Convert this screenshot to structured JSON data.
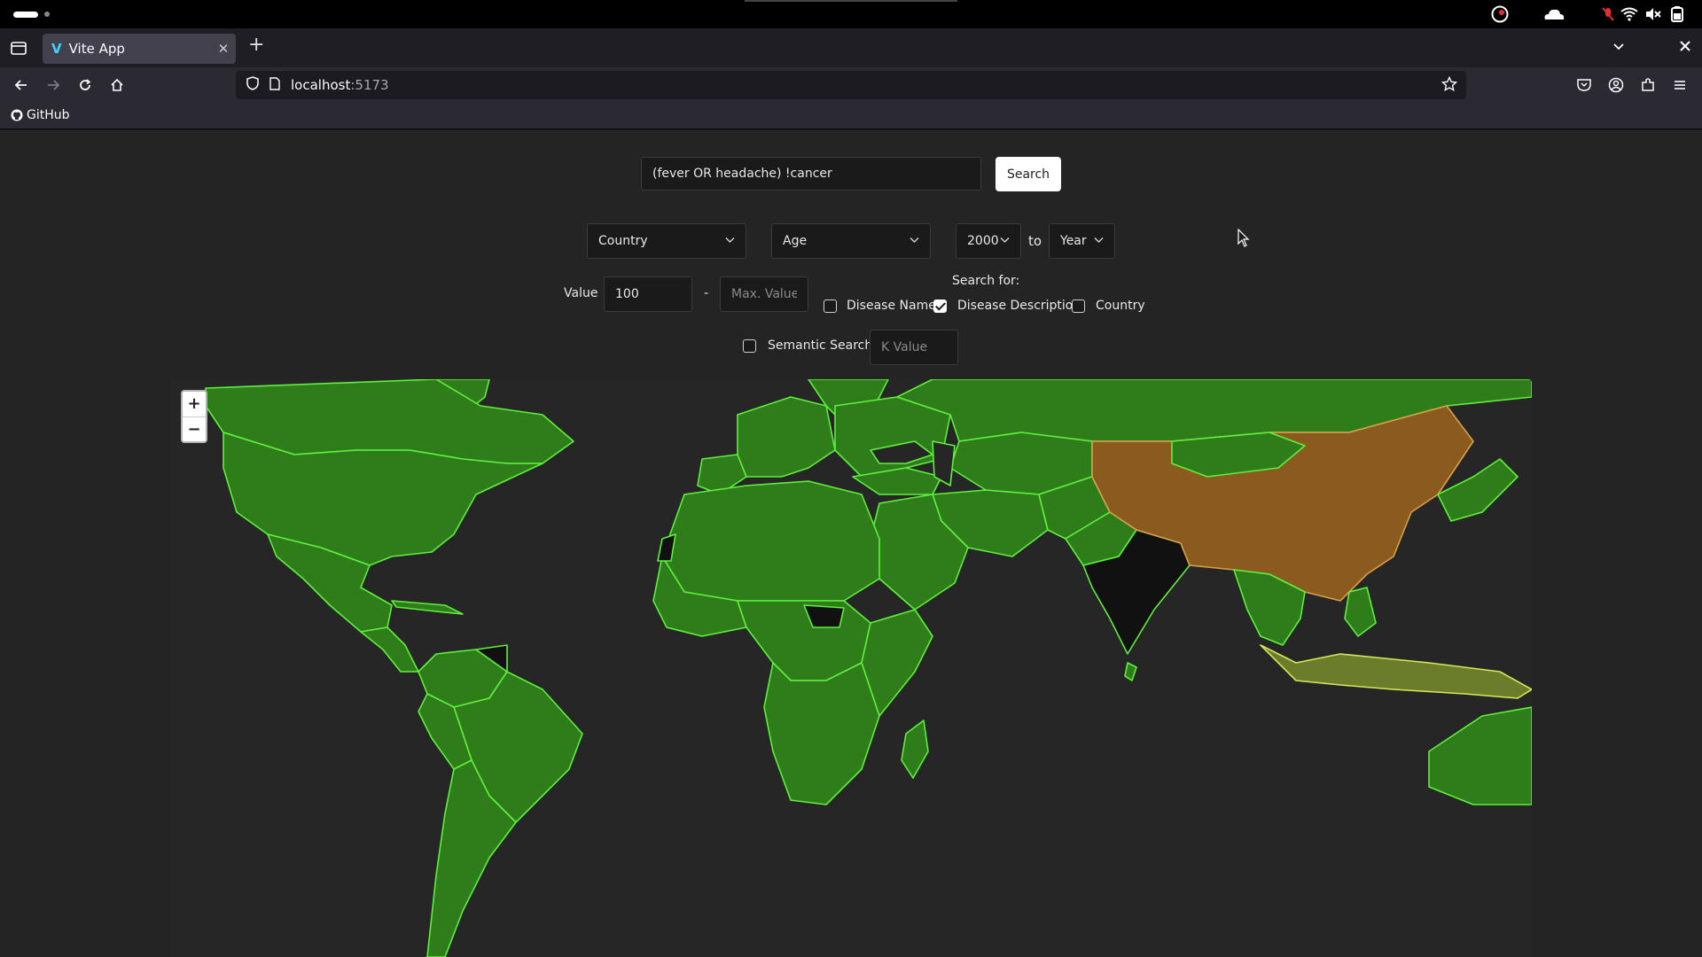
{
  "browser": {
    "tab_title": "Vite App",
    "tab_close": "✕",
    "new_tab": "+",
    "url_host": "localhost",
    "url_port": ":5173",
    "bookmark": "GitHub"
  },
  "search": {
    "query": "(fever OR headache) !cancer",
    "button_label": "Search"
  },
  "filters": {
    "country_label": "Country",
    "age_label": "Age",
    "year_from": "2000",
    "to_label": "to",
    "year_to": "Year"
  },
  "value_filter": {
    "label": "Value",
    "min_value": "100",
    "max_placeholder": "Max. Value",
    "dash": "-"
  },
  "search_for": {
    "title": "Search for:",
    "options": [
      {
        "label": "Disease Name",
        "checked": false
      },
      {
        "label": "Disease Description",
        "checked": true
      },
      {
        "label": "Country",
        "checked": false
      }
    ]
  },
  "semantic": {
    "label": "Semantic Search",
    "checked": false,
    "k_placeholder": "K Value"
  },
  "map": {
    "zoom_in": "+",
    "zoom_out": "−",
    "colors": {
      "land": "#2e7d1a",
      "border": "#5ef03c",
      "ocean": "#262626",
      "highlight_china": "#8a5a1e",
      "highlight_indonesia": "#6b7d2a",
      "nodata": "#111111"
    }
  }
}
